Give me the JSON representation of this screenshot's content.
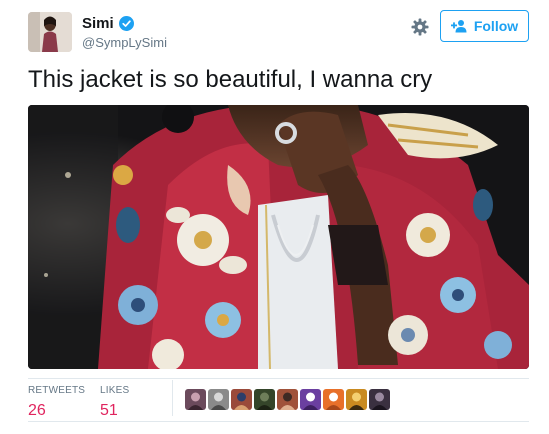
{
  "header": {
    "display_name": "Simi",
    "handle": "@SympLySimi",
    "follow_label": "Follow"
  },
  "tweet": {
    "text": "This jacket is so beautiful, I wanna cry"
  },
  "stats": {
    "retweets_label": "RETWEETS",
    "retweets_count": "26",
    "likes_label": "LIKES",
    "likes_count": "51"
  },
  "colors": {
    "brand_blue": "#1da1f2",
    "count_red": "#e0245e",
    "secondary_text": "#657786"
  },
  "icons": {
    "verified": "verified-badge-icon",
    "settings": "gear-icon",
    "follow": "add-person-icon"
  },
  "likers": [
    {
      "palette": [
        "#6b4a5c",
        "#c9a0b0",
        "#3a2530"
      ]
    },
    {
      "palette": [
        "#8a8a8a",
        "#d8d8d8",
        "#4a4a4a"
      ]
    },
    {
      "palette": [
        "#9a4a3a",
        "#2a3e6a",
        "#d9a070"
      ]
    },
    {
      "palette": [
        "#35452a",
        "#6e7e5a",
        "#1c2214"
      ]
    },
    {
      "palette": [
        "#a0523a",
        "#3d2a24",
        "#e0b090"
      ]
    },
    {
      "palette": [
        "#6b3fa0",
        "#ffffff",
        "#3d2060"
      ]
    },
    {
      "palette": [
        "#e8702a",
        "#ffffff",
        "#a8481a"
      ]
    },
    {
      "palette": [
        "#c98a20",
        "#f4d070",
        "#3a2a10"
      ]
    },
    {
      "palette": [
        "#3a3040",
        "#9a8aa0",
        "#1a141e"
      ]
    }
  ]
}
